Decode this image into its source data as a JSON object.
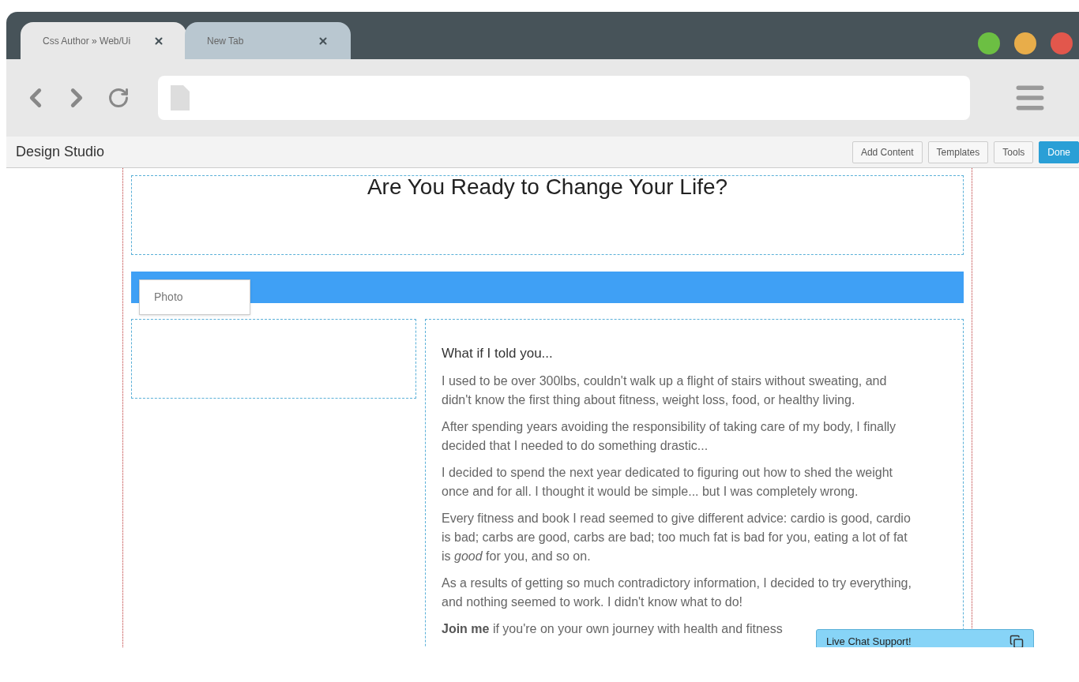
{
  "window": {
    "tabs": [
      {
        "title": "Css Author » Web/Ui",
        "selected": true
      },
      {
        "title": "New Tab",
        "selected": false
      }
    ],
    "controls": [
      {
        "color": "#6cbf43"
      },
      {
        "color": "#e8ad4a"
      },
      {
        "color": "#e2574c"
      }
    ]
  },
  "studio_bar": {
    "title": "Design Studio",
    "buttons": [
      {
        "label": "Add Content",
        "primary": false
      },
      {
        "label": "Templates",
        "primary": false
      },
      {
        "label": "Tools",
        "primary": false
      },
      {
        "label": "Done",
        "primary": true
      }
    ]
  },
  "page": {
    "headline": "Are You Ready to Change Your Life?",
    "photo_label": "Photo",
    "article": {
      "heading": "What if I told you...",
      "paragraphs": [
        "I used to be over 300lbs, couldn't walk up a flight of stairs without sweating, and didn't know the first thing about fitness, weight loss, food, or healthy living.",
        "After spending years avoiding the responsibility of taking care of my body, I finally decided that I needed to do something drastic...",
        "I decided to spend the next year dedicated to figuring out how to shed the weight once and for all. I thought it would be simple... but I was completely wrong.",
        "Every fitness and book I read seemed to give different advice: cardio is good, cardio is bad; carbs are good, carbs are bad; too much fat is bad for you, eating a lot of fat is *good* for you, and so on.",
        "As a results  of getting so much contradictory information, I decided to try everything, and nothing seemed to work. I didn't know what to do!",
        "**Join me** if you're on your own journey with health and fitness"
      ]
    }
  },
  "chat": {
    "title": "Live Chat Support!"
  }
}
